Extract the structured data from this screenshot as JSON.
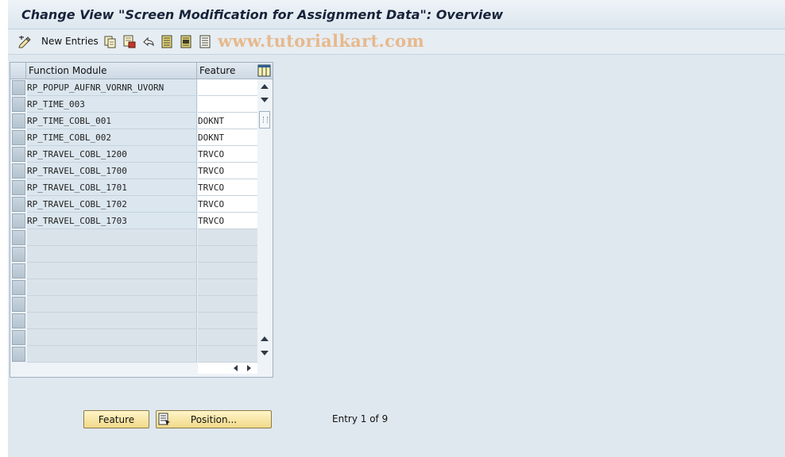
{
  "window": {
    "title": "Change View \"Screen Modification for Assignment Data\": Overview"
  },
  "toolbar": {
    "new_entries_label": "New Entries",
    "watermark": "www.tutorialkart.com"
  },
  "table": {
    "columns": [
      "Function Module",
      "Feature"
    ],
    "rows": [
      {
        "function_module": "RP_POPUP_AUFNR_VORNR_UVORN",
        "feature": ""
      },
      {
        "function_module": "RP_TIME_003",
        "feature": ""
      },
      {
        "function_module": "RP_TIME_COBL_001",
        "feature": "DOKNT"
      },
      {
        "function_module": "RP_TIME_COBL_002",
        "feature": "DOKNT"
      },
      {
        "function_module": "RP_TRAVEL_COBL_1200",
        "feature": "TRVCO"
      },
      {
        "function_module": "RP_TRAVEL_COBL_1700",
        "feature": "TRVCO"
      },
      {
        "function_module": "RP_TRAVEL_COBL_1701",
        "feature": "TRVCO"
      },
      {
        "function_module": "RP_TRAVEL_COBL_1702",
        "feature": "TRVCO"
      },
      {
        "function_module": "RP_TRAVEL_COBL_1703",
        "feature": "TRVCO"
      },
      {
        "function_module": "",
        "feature": ""
      },
      {
        "function_module": "",
        "feature": ""
      },
      {
        "function_module": "",
        "feature": ""
      },
      {
        "function_module": "",
        "feature": ""
      },
      {
        "function_module": "",
        "feature": ""
      },
      {
        "function_module": "",
        "feature": ""
      },
      {
        "function_module": "",
        "feature": ""
      },
      {
        "function_module": "",
        "feature": ""
      }
    ]
  },
  "footer": {
    "feature_button": "Feature",
    "position_button": "Position...",
    "entry_status": "Entry 1 of 9"
  },
  "colors": {
    "button_fill": "#f2d98a",
    "background": "#dfe8ef",
    "watermark": "#e7b98d"
  },
  "icons": [
    "change-display-icon",
    "copy-icon",
    "save-icon",
    "undo-icon",
    "select-all-icon",
    "select-block-icon",
    "deselect-all-icon",
    "column-settings-icon",
    "position-icon"
  ]
}
